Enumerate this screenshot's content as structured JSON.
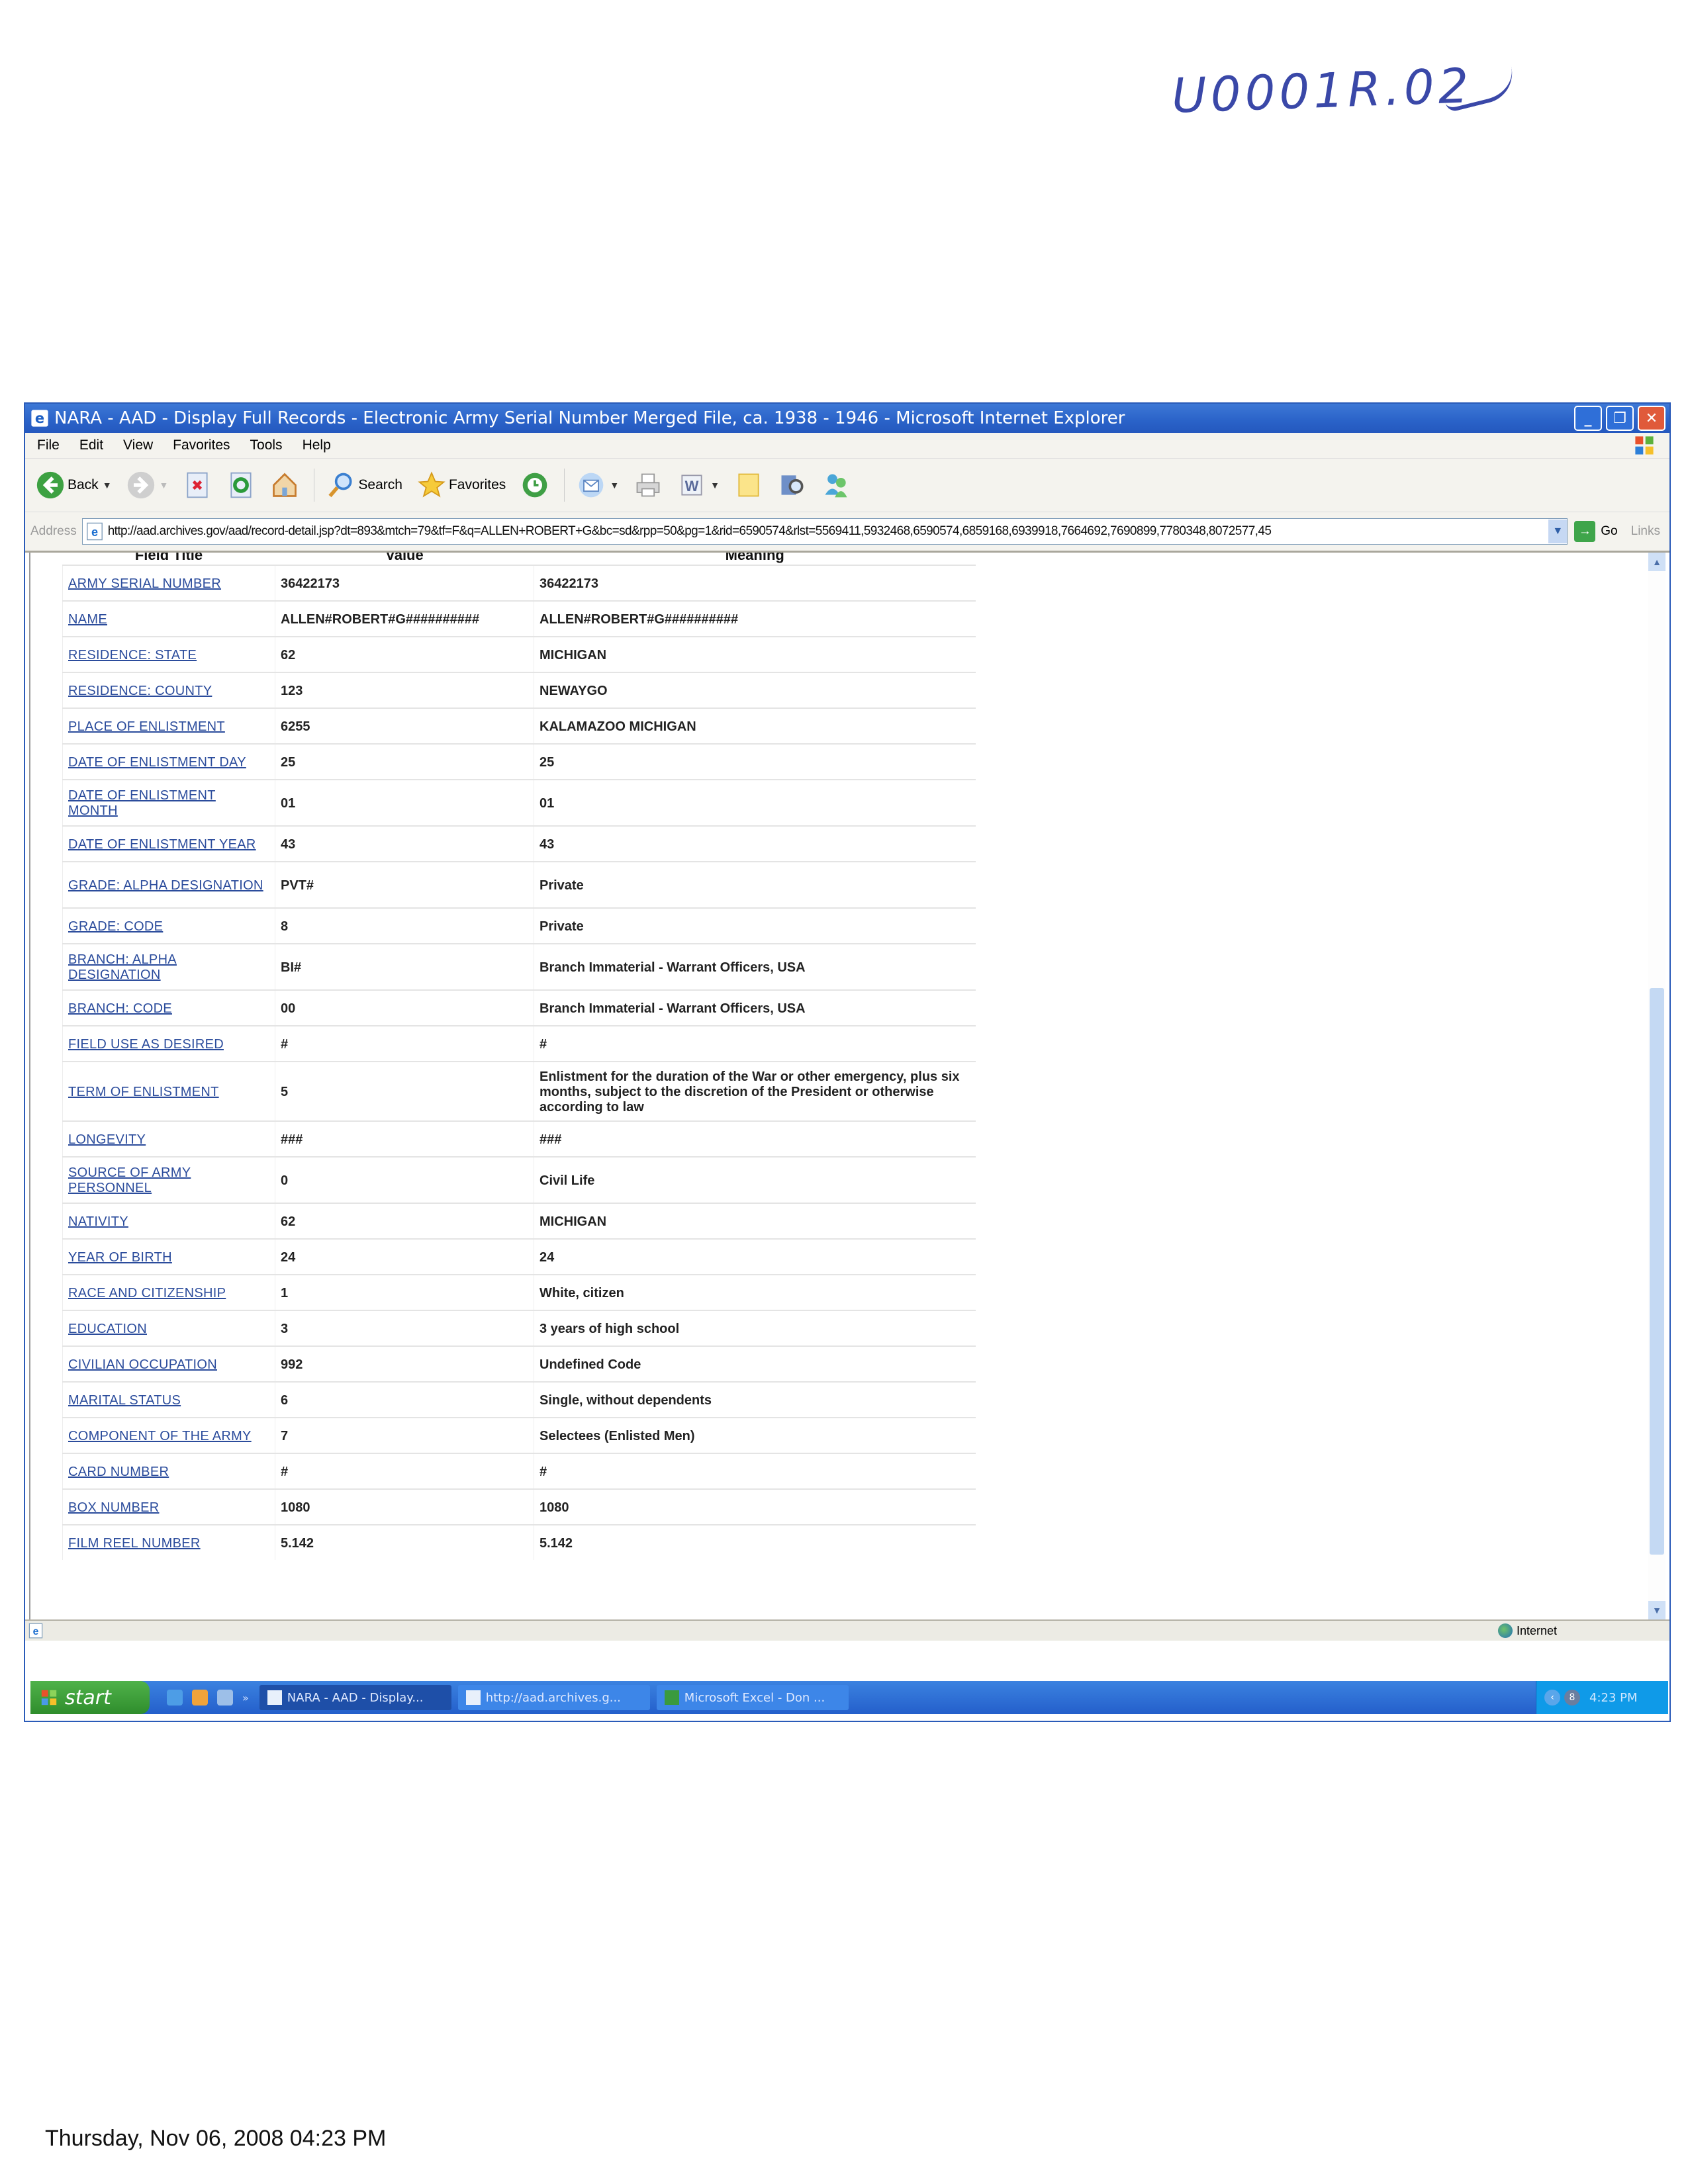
{
  "annotation": {
    "handwritten_label": "U0001R.02"
  },
  "window": {
    "title": "NARA - AAD - Display Full Records - Electronic Army Serial Number Merged File, ca. 1938 - 1946  - Microsoft Internet Explorer",
    "controls": {
      "minimize": "_",
      "restore": "❐",
      "close": "✕"
    }
  },
  "menu": [
    "File",
    "Edit",
    "View",
    "Favorites",
    "Tools",
    "Help"
  ],
  "toolbar": {
    "back_label": "Back",
    "search_label": "Search",
    "favorites_label": "Favorites"
  },
  "address": {
    "label": "Address",
    "url": "http://aad.archives.gov/aad/record-detail.jsp?dt=893&mtch=79&tf=F&q=ALLEN+ROBERT+G&bc=sd&rpp=50&pg=1&rid=6590574&rlst=5569411,5932468,6590574,6859168,6939918,7664692,7690899,7780348,8072577,45",
    "go_label": "Go",
    "links_label": "Links"
  },
  "table": {
    "headers": {
      "field": "Field Title",
      "value": "Value",
      "meaning": "Meaning"
    },
    "rows": [
      {
        "field": "ARMY SERIAL NUMBER",
        "value": "36422173",
        "meaning": "36422173",
        "size": 1
      },
      {
        "field": "NAME",
        "value": "ALLEN#ROBERT#G##########",
        "meaning": "ALLEN#ROBERT#G##########",
        "size": 1
      },
      {
        "field": "RESIDENCE: STATE",
        "value": "62",
        "meaning": "MICHIGAN",
        "size": 1
      },
      {
        "field": "RESIDENCE: COUNTY",
        "value": "123",
        "meaning": "NEWAYGO",
        "size": 1
      },
      {
        "field": "PLACE OF ENLISTMENT",
        "value": "6255",
        "meaning": "KALAMAZOO MICHIGAN",
        "size": 1
      },
      {
        "field": "DATE OF ENLISTMENT DAY",
        "value": "25",
        "meaning": "25",
        "size": 1
      },
      {
        "field": "DATE OF ENLISTMENT MONTH",
        "value": "01",
        "meaning": "01",
        "size": 2
      },
      {
        "field": "DATE OF ENLISTMENT YEAR",
        "value": "43",
        "meaning": "43",
        "size": 1
      },
      {
        "field": "GRADE: ALPHA DESIGNATION",
        "value": "PVT#",
        "meaning": "Private",
        "size": 2
      },
      {
        "field": "GRADE: CODE",
        "value": "8",
        "meaning": "Private",
        "size": 1
      },
      {
        "field": "BRANCH: ALPHA DESIGNATION",
        "value": "BI#",
        "meaning": "Branch Immaterial - Warrant Officers, USA",
        "size": 2
      },
      {
        "field": "BRANCH: CODE",
        "value": "00",
        "meaning": "Branch Immaterial - Warrant Officers, USA",
        "size": 1
      },
      {
        "field": "FIELD USE AS DESIRED",
        "value": "#",
        "meaning": "#",
        "size": 1
      },
      {
        "field": "TERM OF ENLISTMENT",
        "value": "5",
        "meaning": "Enlistment for the duration of the War or other emergency, plus six months, subject to the discretion of the President or otherwise according to law",
        "size": 3
      },
      {
        "field": "LONGEVITY",
        "value": "###",
        "meaning": "###",
        "size": 1
      },
      {
        "field": "SOURCE OF ARMY PERSONNEL",
        "value": "0",
        "meaning": "Civil Life",
        "size": 2
      },
      {
        "field": "NATIVITY",
        "value": "62",
        "meaning": "MICHIGAN",
        "size": 1
      },
      {
        "field": "YEAR OF BIRTH",
        "value": "24",
        "meaning": "24",
        "size": 1
      },
      {
        "field": "RACE AND CITIZENSHIP",
        "value": "1",
        "meaning": "White, citizen",
        "size": 1
      },
      {
        "field": "EDUCATION",
        "value": "3",
        "meaning": "3 years of high school",
        "size": 1
      },
      {
        "field": "CIVILIAN OCCUPATION",
        "value": "992",
        "meaning": "Undefined Code",
        "size": 1
      },
      {
        "field": "MARITAL STATUS",
        "value": "6",
        "meaning": "Single, without dependents",
        "size": 1
      },
      {
        "field": "COMPONENT OF THE ARMY",
        "value": "7",
        "meaning": "Selectees (Enlisted Men)",
        "size": 1
      },
      {
        "field": "CARD NUMBER",
        "value": "#",
        "meaning": "#",
        "size": 1
      },
      {
        "field": "BOX NUMBER",
        "value": "1080",
        "meaning": "1080",
        "size": 1
      },
      {
        "field": "FILM REEL NUMBER",
        "value": "5.142",
        "meaning": "5.142",
        "size": 1
      }
    ]
  },
  "scrollbar": {
    "position_fraction": 0.9,
    "visible_fraction": 0.55
  },
  "status": {
    "zone": "Internet"
  },
  "taskbar": {
    "start_label": "start",
    "tasks": [
      {
        "label": "NARA - AAD - Display...",
        "active": true,
        "icon": "ie-icon"
      },
      {
        "label": "http://aad.archives.g...",
        "active": false,
        "icon": "ie-icon"
      },
      {
        "label": "Microsoft Excel - Don ...",
        "active": false,
        "icon": "excel-icon"
      }
    ],
    "tray_badge": "8",
    "clock": "4:23 PM"
  },
  "print_footer": "Thursday, Nov 06, 2008  04:23 PM"
}
